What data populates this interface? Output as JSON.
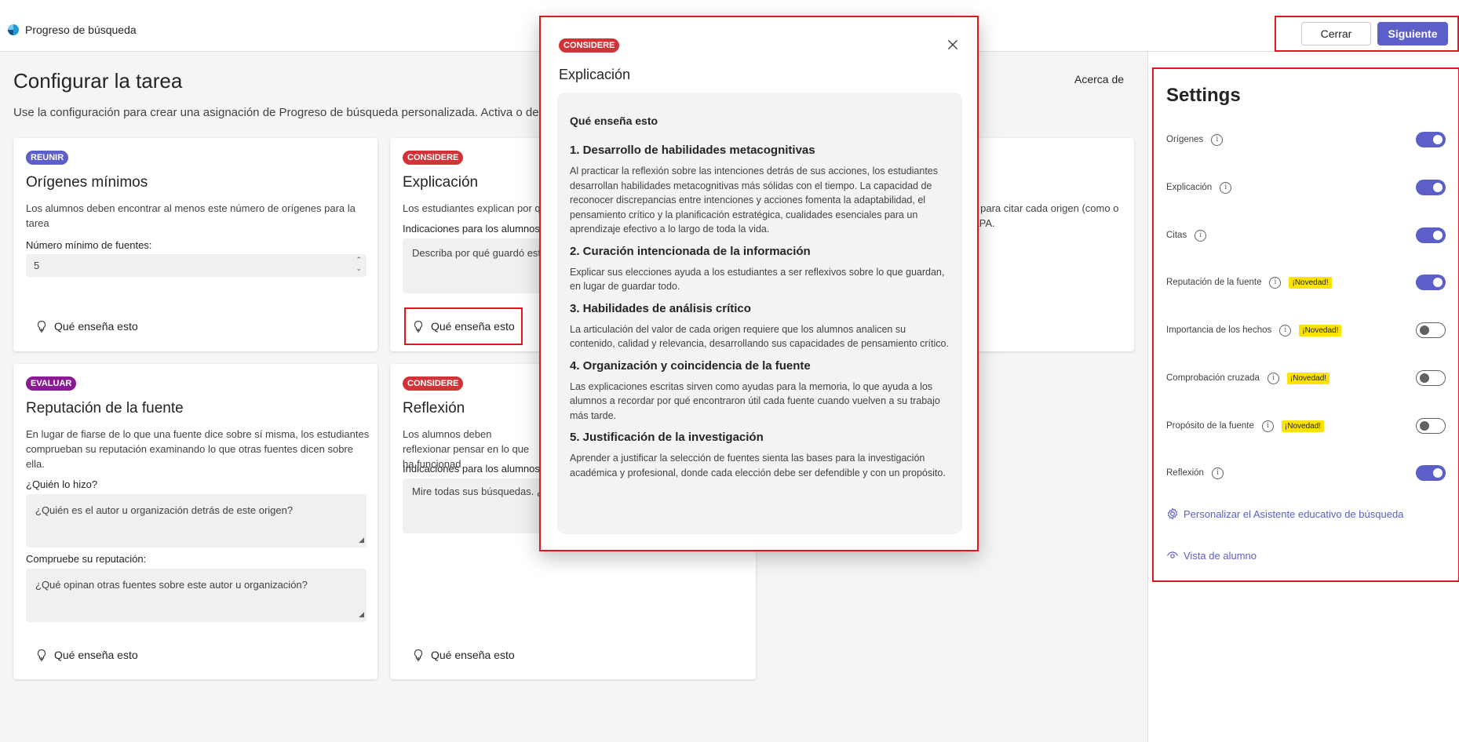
{
  "app": {
    "title": "Progreso de búsqueda"
  },
  "header": {
    "close_label": "Cerrar",
    "next_label": "Siguiente"
  },
  "page": {
    "title": "Configurar la tarea",
    "about_label": "Acerca de",
    "description": "Use la configuración para crear una asignación de Progreso de búsqueda personalizada. Activa o desa"
  },
  "cards": {
    "origins": {
      "tag": "REUNIR",
      "title": "Orígenes mínimos",
      "description": "Los alumnos deben encontrar al menos este número de orígenes para la tarea",
      "field_label": "Número mínimo de fuentes:",
      "field_value": "5",
      "teach_label": "Qué enseña esto"
    },
    "explanation": {
      "tag": "CONSIDERE",
      "title": "Explicación",
      "description": "Los estudiantes explican por q",
      "field_label": "Indicaciones para los alumnos",
      "field_value": "Describa por qué guardó est",
      "teach_label": "Qué enseña esto"
    },
    "citations": {
      "description": "s para citar cada origen (como o APA."
    },
    "reputation": {
      "tag": "EVALUAR",
      "title": "Reputación de la fuente",
      "description": "En lugar de fiarse de lo que una fuente dice sobre sí misma, los estudiantes comprueban su reputación examinando lo que otras fuentes dicen sobre ella.",
      "field1_label": "¿Quién lo hizo?",
      "field1_value": "¿Quién es el autor u organización detrás de este origen?",
      "field2_label": "Compruebe su reputación:",
      "field2_value": "¿Qué opinan otras fuentes sobre este autor u organización?",
      "teach_label": "Qué enseña esto"
    },
    "reflection": {
      "tag": "CONSIDERE",
      "title": "Reflexión",
      "description": "Los alumnos deben reflexionar pensar en lo que ha funcionad",
      "field_label": "Indicaciones para los alumnos",
      "field_value": "Mire todas sus búsquedas. ¿",
      "teach_label": "Qué enseña esto"
    }
  },
  "modal": {
    "tag": "CONSIDERE",
    "title": "Explicación",
    "heading": "Qué enseña esto",
    "sections": [
      {
        "title": "1. Desarrollo de habilidades metacognitivas",
        "text": "Al practicar la reflexión sobre las intenciones detrás de sus acciones, los estudiantes desarrollan habilidades metacognitivas más sólidas con el tiempo. La capacidad de reconocer discrepancias entre intenciones y acciones fomenta la adaptabilidad, el pensamiento crítico y la planificación estratégica, cualidades esenciales para un aprendizaje efectivo a lo largo de toda la vida."
      },
      {
        "title": "2. Curación intencionada de la información",
        "text": "Explicar sus elecciones ayuda a los estudiantes a ser reflexivos sobre lo que guardan, en lugar de guardar todo."
      },
      {
        "title": "3. Habilidades de análisis crítico",
        "text": "La articulación del valor de cada origen requiere que los alumnos analicen su contenido, calidad y relevancia, desarrollando sus capacidades de pensamiento crítico."
      },
      {
        "title": "4. Organización y coincidencia de la fuente",
        "text": "Las explicaciones escritas sirven como ayudas para la memoria, lo que ayuda a los alumnos a recordar por qué encontraron útil cada fuente cuando vuelven a su trabajo más tarde."
      },
      {
        "title": "5. Justificación de la investigación",
        "text": "Aprender a justificar la selección de fuentes sienta las bases para la investigación académica y profesional, donde cada elección debe ser defendible y con un propósito."
      }
    ]
  },
  "settings": {
    "title": "Settings",
    "new_badge": "¡Novedad!",
    "items": [
      {
        "label": "Orígenes",
        "on": true,
        "new": false
      },
      {
        "label": "Explicación",
        "on": true,
        "new": false
      },
      {
        "label": "Citas",
        "on": true,
        "new": false
      },
      {
        "label": "Reputación de la fuente",
        "on": true,
        "new": true
      },
      {
        "label": "Importancia de los hechos",
        "on": false,
        "new": true
      },
      {
        "label": "Comprobación cruzada",
        "on": false,
        "new": true
      },
      {
        "label": "Propósito de la fuente",
        "on": false,
        "new": true
      },
      {
        "label": "Reflexión",
        "on": true,
        "new": false
      }
    ],
    "customize_label": "Personalizar el Asistente educativo de búsqueda",
    "student_view_label": "Vista de alumno"
  },
  "colors": {
    "accent": "#5b5fc7",
    "considere": "#d13438",
    "evaluar": "#8a1b94",
    "highlight": "#e0171f",
    "new_badge": "#fde300"
  }
}
